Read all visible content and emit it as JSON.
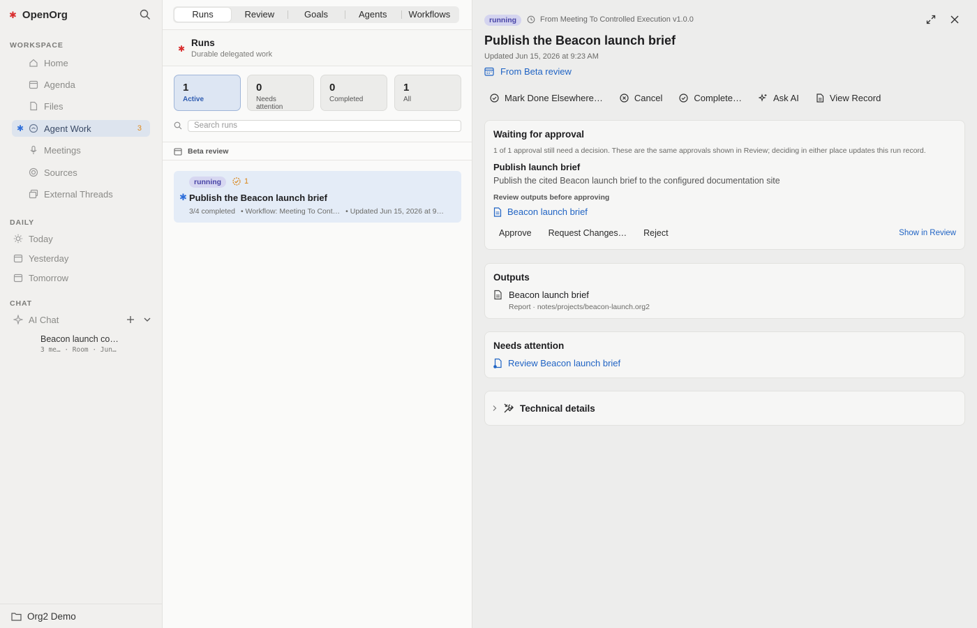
{
  "app": {
    "name": "OpenOrg"
  },
  "sidebar": {
    "workspace_title": "WORKSPACE",
    "items": [
      {
        "label": "Home",
        "icon": "home-icon"
      },
      {
        "label": "Agenda",
        "icon": "calendar-icon"
      },
      {
        "label": "Files",
        "icon": "file-icon"
      },
      {
        "label": "Agent Work",
        "icon": "agent-icon",
        "badge": "3",
        "active": true
      },
      {
        "label": "Meetings",
        "icon": "mic-icon"
      },
      {
        "label": "Sources",
        "icon": "sources-icon"
      },
      {
        "label": "External Threads",
        "icon": "threads-icon"
      }
    ],
    "daily_title": "DAILY",
    "daily": [
      {
        "label": "Today",
        "icon": "sun-icon"
      },
      {
        "label": "Yesterday",
        "icon": "calendar-icon"
      },
      {
        "label": "Tomorrow",
        "icon": "calendar-icon"
      }
    ],
    "chat_title": "CHAT",
    "chat": {
      "label": "AI Chat"
    },
    "room": {
      "title": "Beacon launch co…",
      "meta": "3 me… · Room · Jun…"
    },
    "footer": "Org2 Demo"
  },
  "middle": {
    "tabs": [
      "Runs",
      "Review",
      "Goals",
      "Agents",
      "Workflows"
    ],
    "active_tab": "Runs",
    "header": {
      "title": "Runs",
      "subtitle": "Durable delegated work"
    },
    "stats": [
      {
        "n": "1",
        "label": "Active"
      },
      {
        "n": "0",
        "label": "Needs attention"
      },
      {
        "n": "0",
        "label": "Completed"
      },
      {
        "n": "1",
        "label": "All"
      }
    ],
    "search_placeholder": "Search runs",
    "group": "Beta review",
    "run": {
      "status": "running",
      "approvals": "1",
      "title": "Publish the Beacon launch brief",
      "progress": "3/4 completed",
      "workflow": "• Workflow: Meeting To Cont…",
      "updated": "• Updated Jun 15, 2026 at 9…"
    }
  },
  "detail": {
    "status": "running",
    "origin": "From Meeting To Controlled Execution v1.0.0",
    "title": "Publish the Beacon launch brief",
    "updated": "Updated Jun 15, 2026 at 9:23 AM",
    "from": "From Beta review",
    "actions": [
      "Mark Done Elsewhere…",
      "Cancel",
      "Complete…",
      "Ask AI",
      "View Record"
    ],
    "approval": {
      "title": "Waiting for approval",
      "note": "1 of 1 approval still need a decision. These are the same approvals shown in Review; deciding in either place updates this run record.",
      "item_title": "Publish launch brief",
      "item_desc": "Publish the cited Beacon launch brief to the configured documentation site",
      "review_label": "Review outputs before approving",
      "output_link": "Beacon launch brief",
      "buttons": [
        "Approve",
        "Request Changes…",
        "Reject"
      ],
      "show_in_review": "Show in Review"
    },
    "outputs": {
      "title": "Outputs",
      "name": "Beacon launch brief",
      "sub": "Report · notes/projects/beacon-launch.org2"
    },
    "attention": {
      "title": "Needs attention",
      "link": "Review Beacon launch brief"
    },
    "technical": {
      "title": "Technical details"
    }
  },
  "colors": {
    "accent": "#1f63c4",
    "brand_star": "#d92e2e",
    "running_pill": "#d4d4ef",
    "warning": "#d98416"
  }
}
